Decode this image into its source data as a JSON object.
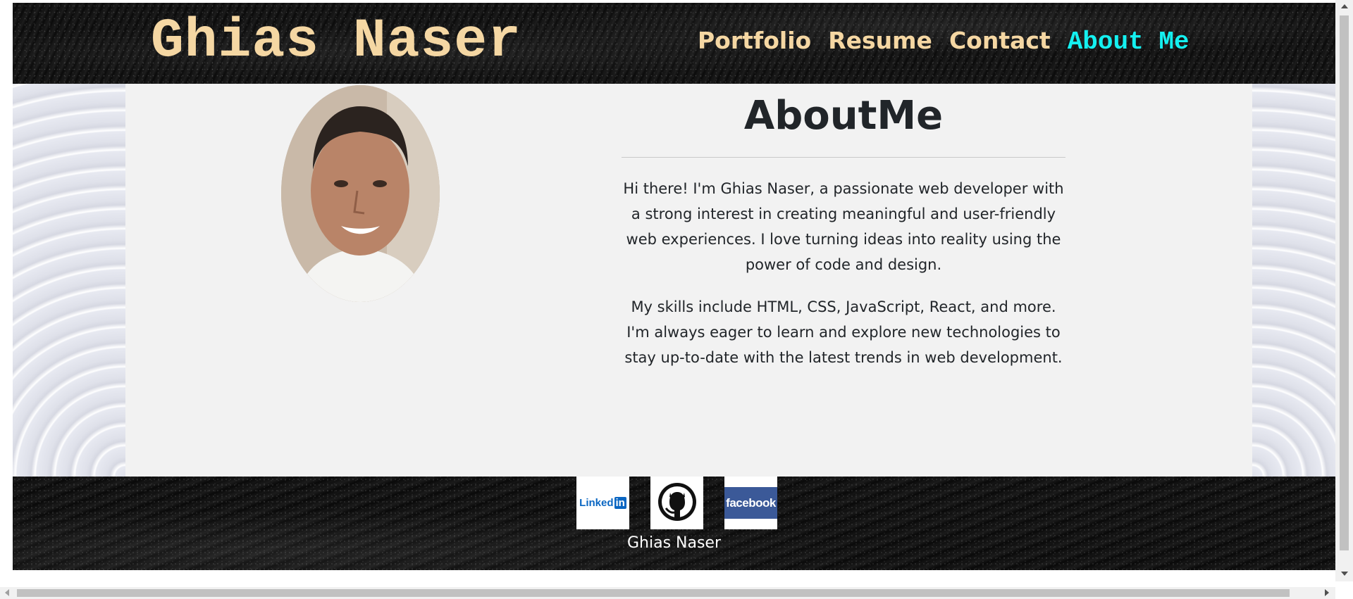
{
  "header": {
    "title": "Ghias Naser",
    "nav": [
      "Portfolio",
      "Resume",
      "Contact",
      "About Me"
    ],
    "active_nav": "About Me"
  },
  "about": {
    "heading": "AboutMe",
    "paragraph1": "Hi there! I'm Ghias Naser, a passionate web developer with a strong interest in creating meaningful and user-friendly web experiences. I love turning ideas into reality using the power of code and design.",
    "paragraph2": "My skills include HTML, CSS, JavaScript, React, and more. I'm always eager to learn and explore new technologies to stay up-to-date with the latest trends in web development."
  },
  "footer": {
    "socials": [
      {
        "name": "LinkedIn",
        "logo_text": "Linked",
        "logo_badge": "in",
        "icon": "linkedin-icon"
      },
      {
        "name": "GitHub",
        "icon": "github-icon"
      },
      {
        "name": "facebook",
        "logo_text": "facebook",
        "icon": "facebook-icon"
      }
    ],
    "name": "Ghias Naser"
  },
  "colors": {
    "title": "#f5d7a3",
    "nav_active": "#14f0f0",
    "main_bg": "#f2f2f2",
    "text": "#212529",
    "linkedin": "#0a66c2",
    "facebook": "#3b5998"
  }
}
